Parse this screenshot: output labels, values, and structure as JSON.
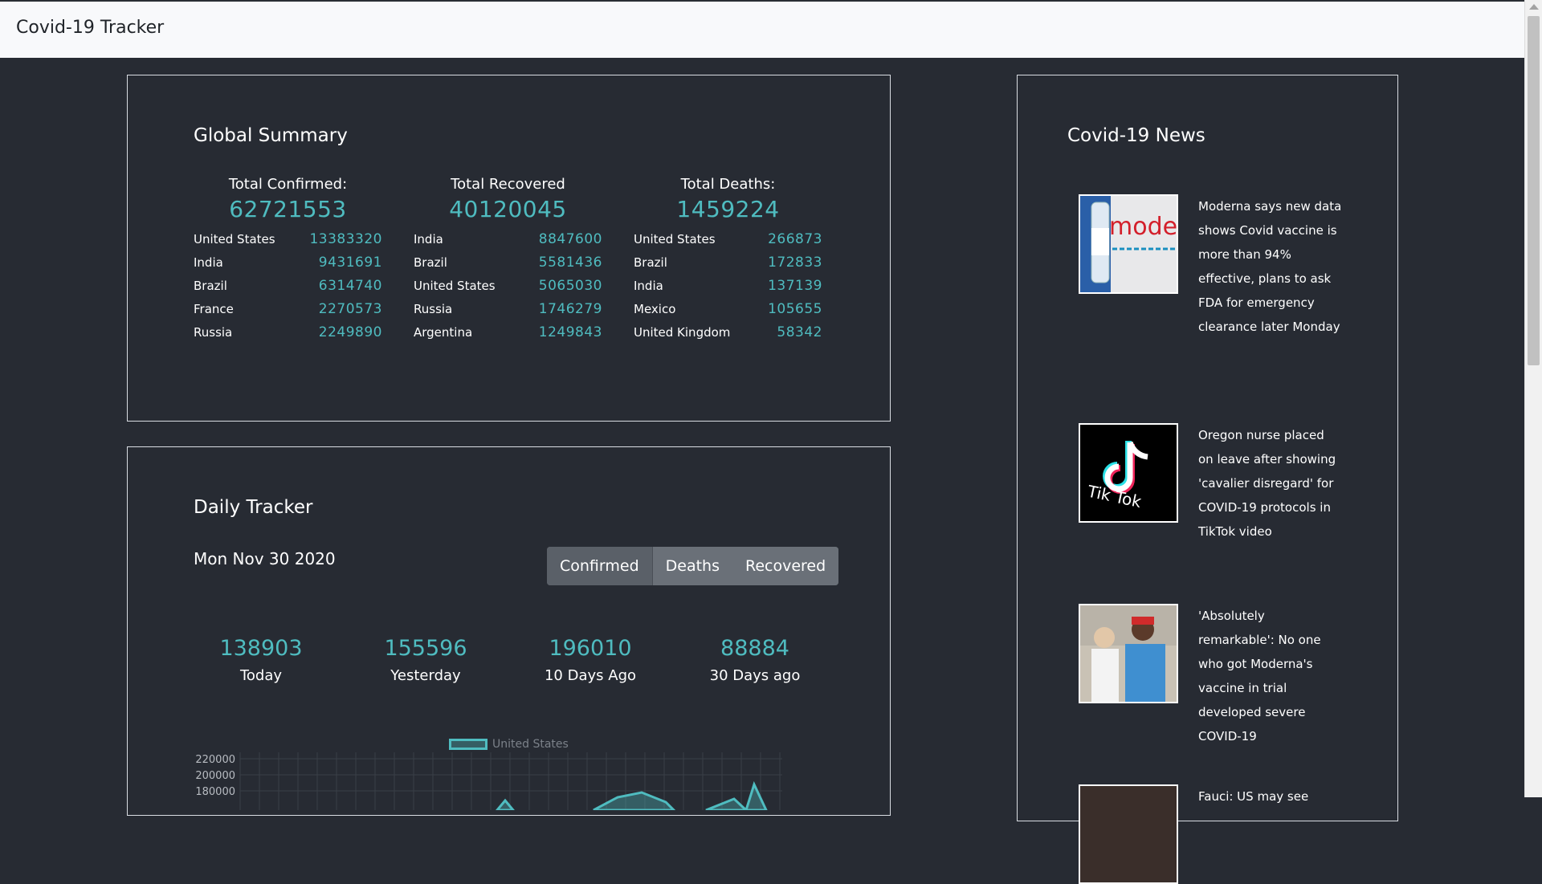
{
  "app": {
    "brand": "Covid-19 Tracker"
  },
  "summary": {
    "title": "Global Summary",
    "confirmed": {
      "label": "Total Confirmed:",
      "total": "62721553",
      "rows": [
        {
          "country": "United States",
          "value": "13383320"
        },
        {
          "country": "India",
          "value": "9431691"
        },
        {
          "country": "Brazil",
          "value": "6314740"
        },
        {
          "country": "France",
          "value": "2270573"
        },
        {
          "country": "Russia",
          "value": "2249890"
        }
      ]
    },
    "recovered": {
      "label": "Total Recovered",
      "total": "40120045",
      "rows": [
        {
          "country": "India",
          "value": "8847600"
        },
        {
          "country": "Brazil",
          "value": "5581436"
        },
        {
          "country": "United States",
          "value": "5065030"
        },
        {
          "country": "Russia",
          "value": "1746279"
        },
        {
          "country": "Argentina",
          "value": "1249843"
        }
      ]
    },
    "deaths": {
      "label": "Total Deaths:",
      "total": "1459224",
      "rows": [
        {
          "country": "United States",
          "value": "266873"
        },
        {
          "country": "Brazil",
          "value": "172833"
        },
        {
          "country": "India",
          "value": "137139"
        },
        {
          "country": "Mexico",
          "value": "105655"
        },
        {
          "country": "United Kingdom",
          "value": "58342"
        }
      ]
    }
  },
  "daily": {
    "title": "Daily Tracker",
    "date": "Mon Nov 30 2020",
    "tabs": [
      "Confirmed",
      "Deaths",
      "Recovered"
    ],
    "active_tab": "Confirmed",
    "stats": [
      {
        "value": "138903",
        "label": "Today"
      },
      {
        "value": "155596",
        "label": "Yesterday"
      },
      {
        "value": "196010",
        "label": "10 Days Ago"
      },
      {
        "value": "88884",
        "label": "30 Days ago"
      }
    ]
  },
  "chart_data": {
    "type": "area",
    "series": [
      {
        "name": "United States"
      }
    ],
    "y_tick_labels": [
      "220000",
      "200000",
      "180000"
    ],
    "grid": true,
    "legend": "top-center"
  },
  "news": {
    "title": "Covid-19 News",
    "items": [
      {
        "headline": "Moderna says new data shows Covid vaccine is more than 94% effective, plans to ask FDA for emergency clearance later Monday",
        "image": "moderna-vaccine-image",
        "image_text": "moderna"
      },
      {
        "headline": "Oregon nurse placed on leave after showing 'cavalier disregard' for COVID-19 protocols in TikTok video",
        "image": "tiktok-logo-image",
        "image_text": "Tik Tok"
      },
      {
        "headline": "'Absolutely remarkable': No one who got Moderna's vaccine in trial developed severe COVID-19",
        "image": "vaccine-trial-photo"
      },
      {
        "headline": "Fauci: US may see",
        "image": "news-photo"
      }
    ]
  },
  "colors": {
    "accent": "#4fbcc0",
    "background": "#272b33",
    "topbar": "#f8f9fb"
  }
}
